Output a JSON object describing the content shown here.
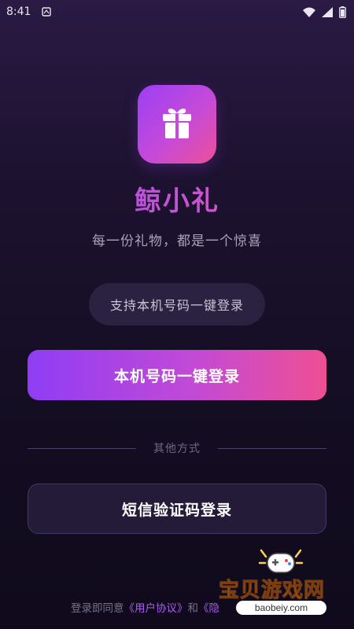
{
  "status_bar": {
    "time": "8:41"
  },
  "app": {
    "name": "鲸小礼",
    "slogan": "每一份礼物，都是一个惊喜"
  },
  "login": {
    "phone_hint": "支持本机号码一键登录",
    "primary_button": "本机号码一键登录",
    "other_methods": "其他方式",
    "sms_button": "短信验证码登录"
  },
  "agreement": {
    "prefix": "登录即同意",
    "user_agreement": "《用户协议》",
    "and": "和",
    "privacy_partial": "《隐"
  },
  "watermark": {
    "title": "宝贝游戏网",
    "url": "baobeiy.com"
  },
  "colors": {
    "accent_start": "#8f3df5",
    "accent_end": "#ef4f93",
    "link": "#a65ee8"
  }
}
